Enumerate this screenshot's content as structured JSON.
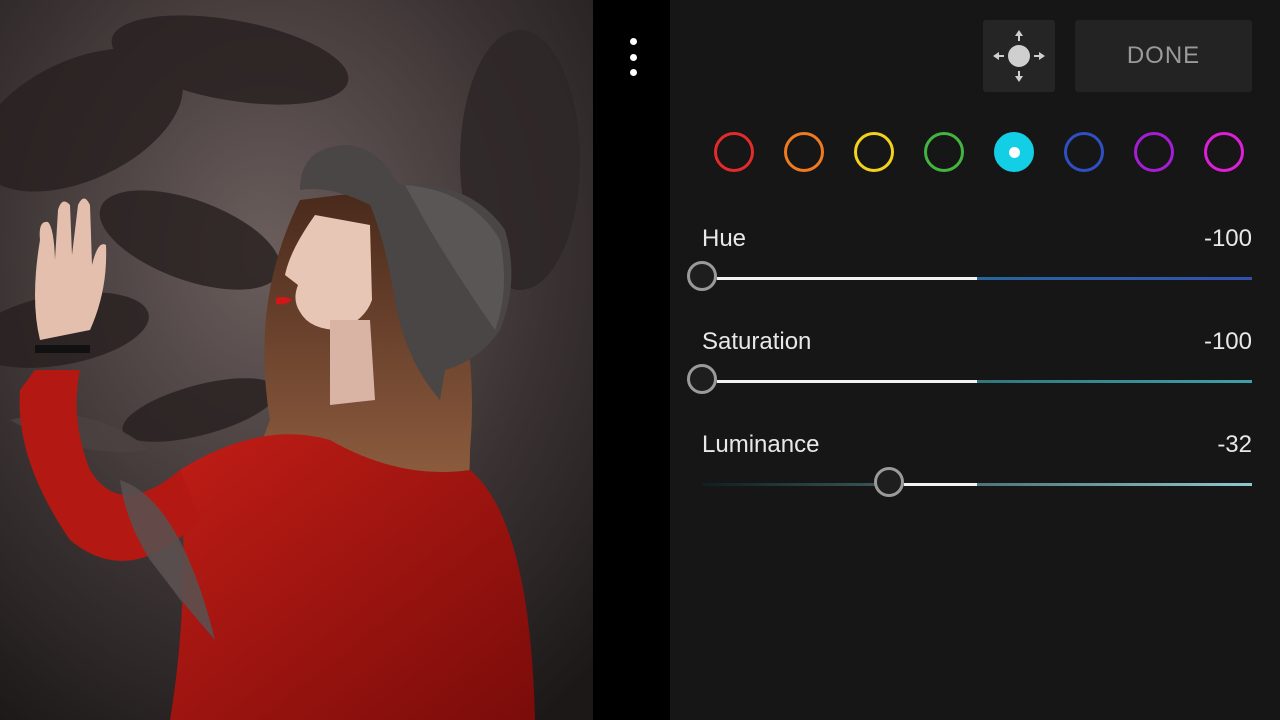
{
  "toolbar": {
    "more_icon": "more-vertical-icon",
    "target_icon": "target-adjust-icon",
    "done_label": "DONE"
  },
  "color_mix": {
    "swatches": [
      {
        "name": "red",
        "color": "#e22b2b",
        "selected": false
      },
      {
        "name": "orange",
        "color": "#ef7a1f",
        "selected": false
      },
      {
        "name": "yellow",
        "color": "#f3d21c",
        "selected": false
      },
      {
        "name": "green",
        "color": "#43b43f",
        "selected": false
      },
      {
        "name": "aqua",
        "color": "#13cfe6",
        "selected": true
      },
      {
        "name": "blue",
        "color": "#2f4fc2",
        "selected": false
      },
      {
        "name": "purple",
        "color": "#a41ed6",
        "selected": false
      },
      {
        "name": "magenta",
        "color": "#df1ed7",
        "selected": false
      }
    ],
    "sliders": [
      {
        "label": "Hue",
        "value": "-100",
        "numeric": -100,
        "track_colors": [
          "#1c7c8a",
          "#3350b0"
        ]
      },
      {
        "label": "Saturation",
        "value": "-100",
        "numeric": -100,
        "track_colors": [
          "#254c50",
          "#3fa0a8"
        ]
      },
      {
        "label": "Luminance",
        "value": "-32",
        "numeric": -32,
        "track_colors": [
          "#0f1f20",
          "#8fc9cc"
        ]
      }
    ],
    "range": [
      -100,
      100
    ]
  }
}
